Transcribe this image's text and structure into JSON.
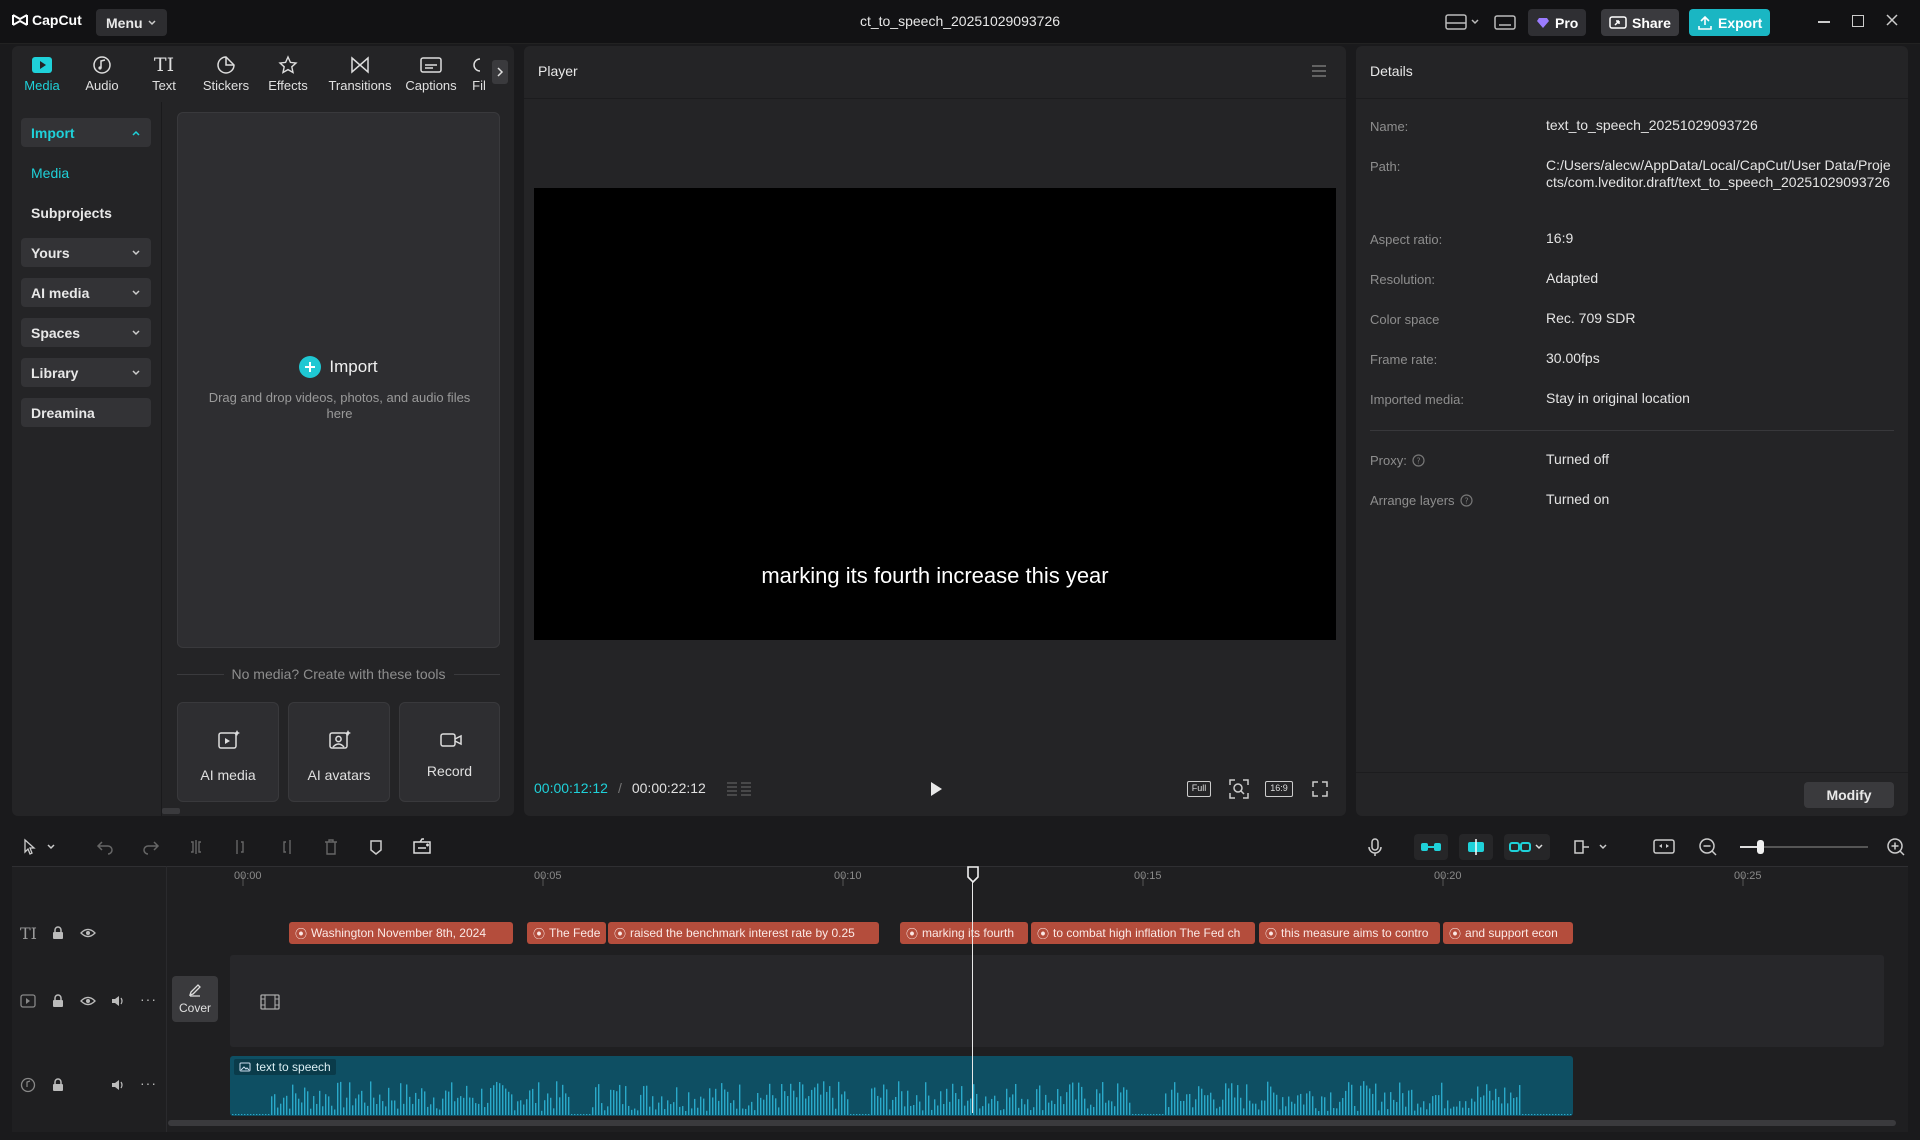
{
  "app": {
    "name": "CapCut",
    "menu_label": "Menu",
    "doc_title": "ct_to_speech_20251029093726"
  },
  "titlebar": {
    "pro_label": "Pro",
    "share_label": "Share",
    "export_label": "Export"
  },
  "tool_tabs": [
    {
      "label": "Media",
      "icon": "media-icon"
    },
    {
      "label": "Audio",
      "icon": "audio-icon"
    },
    {
      "label": "Text",
      "icon": "text-icon"
    },
    {
      "label": "Stickers",
      "icon": "stickers-icon"
    },
    {
      "label": "Effects",
      "icon": "effects-icon"
    },
    {
      "label": "Transitions",
      "icon": "transitions-icon"
    },
    {
      "label": "Captions",
      "icon": "captions-icon"
    },
    {
      "label": "Fil",
      "icon": "filters-icon"
    }
  ],
  "sidebar": {
    "items": [
      {
        "label": "Import"
      },
      {
        "label": "Media"
      },
      {
        "label": "Subprojects"
      },
      {
        "label": "Yours"
      },
      {
        "label": "AI media"
      },
      {
        "label": "Spaces"
      },
      {
        "label": "Library"
      },
      {
        "label": "Dreamina"
      }
    ]
  },
  "import_area": {
    "title": "Import",
    "hint": "Drag and drop videos, photos, and audio files here"
  },
  "tools": {
    "divider_label": "No media? Create with these tools",
    "ai_media": "AI media",
    "ai_avatars": "AI avatars",
    "record": "Record"
  },
  "player": {
    "title": "Player",
    "subtitle": "marking its fourth increase this year",
    "current_time": "00:00:12:12",
    "separator": "/",
    "total_time": "00:00:22:12",
    "full_label": "Full",
    "ratio_label": "16:9"
  },
  "details": {
    "title": "Details",
    "rows": [
      {
        "label": "Name:",
        "value": "text_to_speech_20251029093726"
      },
      {
        "label": "Path:",
        "value": "C:/Users/alecw/AppData/Local/CapCut/User Data/Projects/com.lveditor.draft/text_to_speech_20251029093726"
      },
      {
        "label": "Aspect ratio:",
        "value": "16:9"
      },
      {
        "label": "Resolution:",
        "value": "Adapted"
      },
      {
        "label": "Color space",
        "value": "Rec. 709 SDR"
      },
      {
        "label": "Frame rate:",
        "value": "30.00fps"
      },
      {
        "label": "Imported media:",
        "value": "Stay in original location"
      },
      {
        "label": "Proxy:",
        "value": "Turned off"
      },
      {
        "label": "Arrange layers",
        "value": "Turned on"
      }
    ],
    "modify_label": "Modify"
  },
  "timeline": {
    "ruler": [
      "00:00",
      "00:05",
      "00:10",
      "00:15",
      "00:20",
      "00:25"
    ],
    "cover_label": "Cover",
    "captions": [
      "Washington November 8th, 2024",
      "The Fede",
      "raised the benchmark interest rate by 0.25",
      "marking its fourth",
      "to combat high inflation The Fed ch",
      "this measure aims to contro",
      "and support econ"
    ],
    "audio_label": "text to speech"
  },
  "colors": {
    "accent": "#1fd1d9",
    "caption_clip": "#b44d3c",
    "audio_clip": "#0e4f63",
    "export_bg": "#1ab6c3"
  }
}
